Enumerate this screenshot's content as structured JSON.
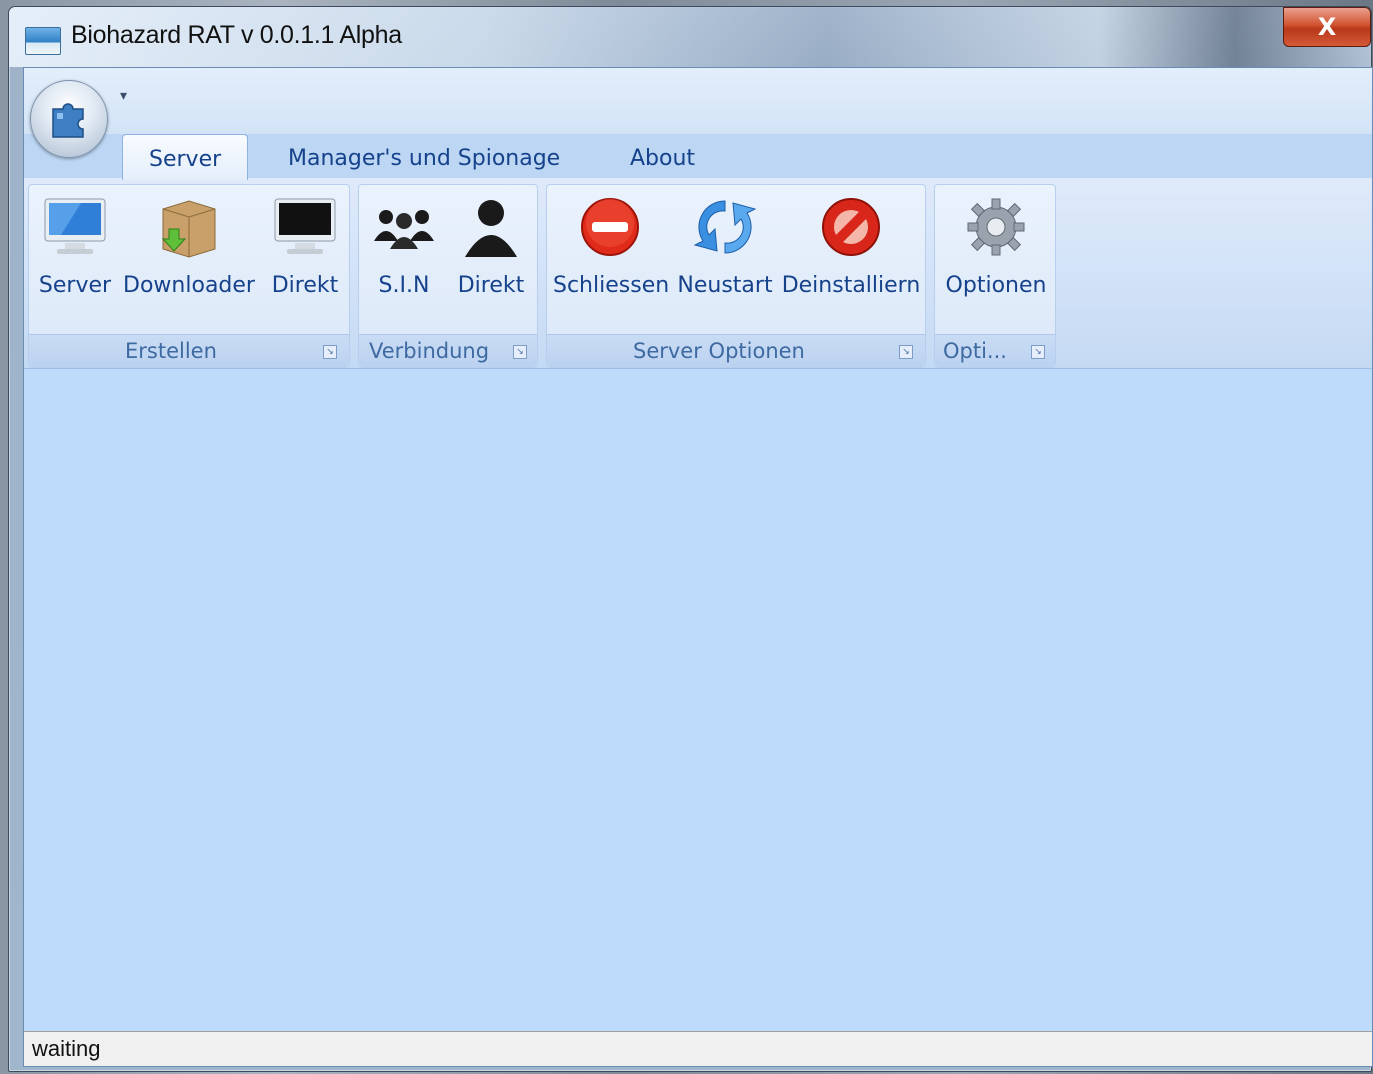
{
  "window": {
    "title": "Biohazard RAT v 0.0.1.1 Alpha",
    "close_label": "X"
  },
  "quick_access": {
    "dropdown_glyph": "▾"
  },
  "tabs": [
    {
      "label": "Server",
      "active": true
    },
    {
      "label": "Manager's und Spionage",
      "active": false
    },
    {
      "label": "About",
      "active": false
    }
  ],
  "ribbon": {
    "groups": [
      {
        "label": "Erstellen",
        "buttons": [
          {
            "label": "Server",
            "icon": "monitor-icon"
          },
          {
            "label": "Downloader",
            "icon": "package-download-icon"
          },
          {
            "label": "Direkt",
            "icon": "dark-monitor-icon"
          }
        ]
      },
      {
        "label": "Verbindung",
        "buttons": [
          {
            "label": "S.I.N",
            "icon": "users-group-icon"
          },
          {
            "label": "Direkt",
            "icon": "user-icon"
          }
        ]
      },
      {
        "label": "Server Optionen",
        "buttons": [
          {
            "label": "Schliessen",
            "icon": "stop-icon"
          },
          {
            "label": "Neustart",
            "icon": "refresh-icon"
          },
          {
            "label": "Deinstalliern",
            "icon": "forbidden-icon"
          }
        ]
      },
      {
        "label": "Opti...",
        "buttons": [
          {
            "label": "Optionen",
            "icon": "gear-icon"
          }
        ]
      }
    ],
    "launcher_glyph": "↘"
  },
  "status": {
    "text": "waiting"
  },
  "colors": {
    "workspace": "#bfdbfb",
    "ribbon_text": "#15428b",
    "close_button": "#c9452a"
  }
}
